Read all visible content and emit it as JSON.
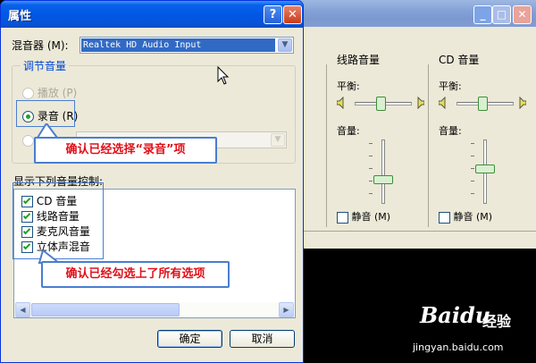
{
  "background_window": {
    "line_column": {
      "title": "线路音量",
      "balance_label": "平衡:",
      "volume_label": "音量:",
      "mute_label": "静音 (M)",
      "volume_level": 0.35
    },
    "cd_column": {
      "title": "CD 音量",
      "balance_label": "平衡:",
      "volume_label": "音量:",
      "mute_label": "静音 (M)",
      "volume_level": 0.55
    }
  },
  "dialog": {
    "title": "属性",
    "help_button": "?",
    "close_button": "✕",
    "mixer_label": "混音器 (M):",
    "mixer_device": "Realtek HD Audio Input",
    "adjust_group_title": "调节音量",
    "radio_options": [
      {
        "label": "播放 (P)",
        "state": "disabled"
      },
      {
        "label": "录音 (R)",
        "state": "selected"
      },
      {
        "label": "其",
        "state": "disabled"
      }
    ],
    "show_controls_label": "显示下列音量控制:",
    "controls": [
      {
        "label": "CD 音量",
        "checked": true
      },
      {
        "label": "线路音量",
        "checked": true
      },
      {
        "label": "麦克风音量",
        "checked": true
      },
      {
        "label": "立体声混音",
        "checked": true
      }
    ],
    "ok_label": "确定",
    "cancel_label": "取消"
  },
  "callouts": {
    "recording": "确认已经选择“录音”项",
    "all_checked": "确认已经勾选上了所有选项"
  },
  "watermark": {
    "logo": "Baidu",
    "brand": "经验",
    "url": "jingyan.baidu.com"
  }
}
